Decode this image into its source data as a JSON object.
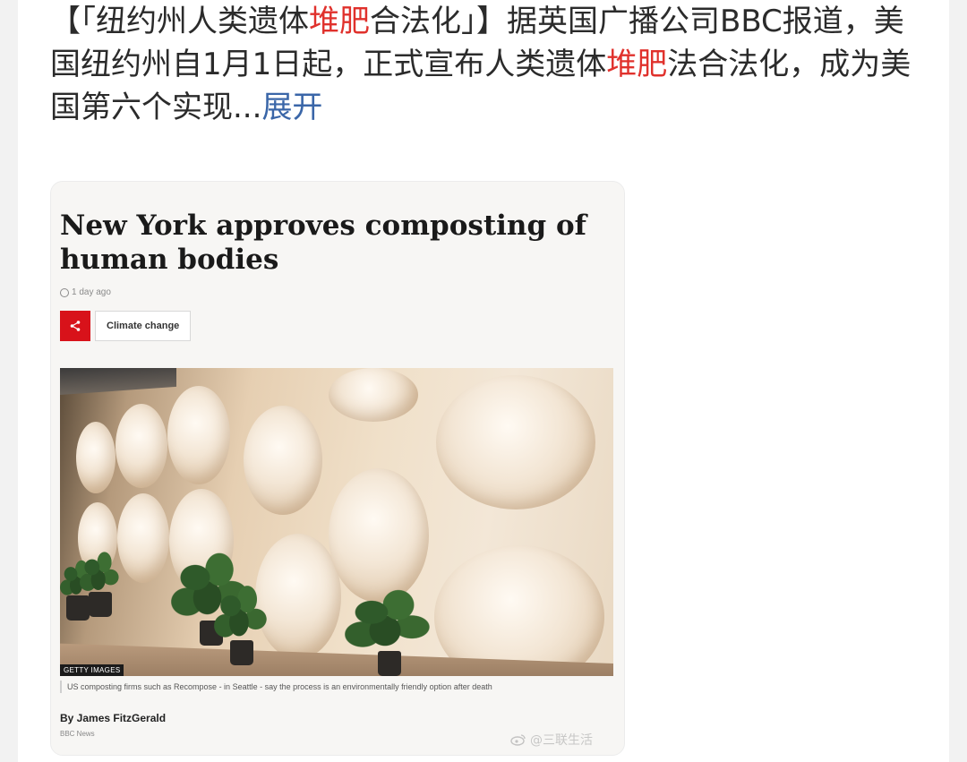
{
  "post": {
    "text_part1": "【「纽约州人类遗体",
    "highlight1": "堆肥",
    "text_part2": "合法化」】据英国广播公司BBC报道，美国纽约州自1月1日起，正式宣布人类遗体",
    "highlight2": "堆肥",
    "text_part3": "法合法化，成为美国第六个实现...",
    "expand_label": "展开"
  },
  "article": {
    "headline": "New York approves composting of human bodies",
    "timestamp": "1 day ago",
    "share_icon": "share-icon",
    "topic_tag": "Climate change",
    "photo_credit": "GETTY IMAGES",
    "caption": "US composting firms such as Recompose - in Seattle - say the process is an environmentally friendly option after death",
    "byline": "By James FitzGerald",
    "source": "BBC News"
  },
  "watermark": {
    "text": "@三联生活",
    "icon": "weibo-icon"
  },
  "colors": {
    "highlight": "#e0312c",
    "link": "#3a66a8",
    "bbc_red": "#d8121a"
  }
}
